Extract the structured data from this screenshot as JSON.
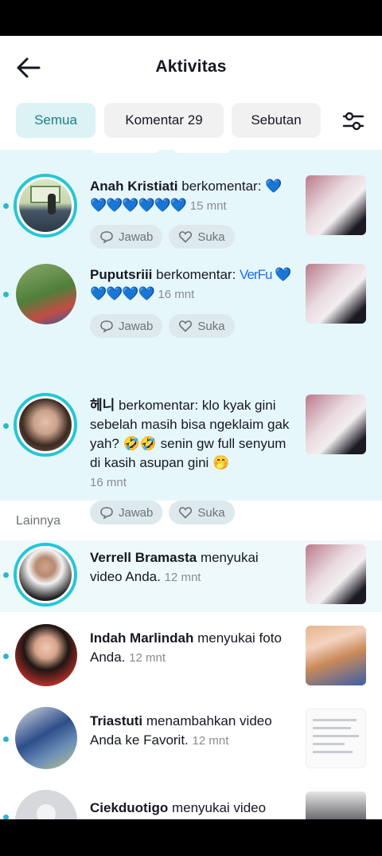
{
  "header": {
    "title": "Aktivitas",
    "back_icon": "arrow-left-icon"
  },
  "tabs": [
    {
      "label": "Semua",
      "active": true
    },
    {
      "label": "Komentar 29",
      "active": false
    },
    {
      "label": "Sebutan",
      "active": false
    }
  ],
  "filter_icon": "sliders-icon",
  "comments": [
    {
      "name": "Anah Kristiati",
      "verb": "berkomentar:",
      "text": "💙💙💙💙💙💙💙",
      "time": "15 mnt",
      "reply": "Jawab",
      "like": "Suka"
    },
    {
      "name": "Puputsriii",
      "verb": "berkomentar:",
      "text": "VerFu 💙💙💙💙💙",
      "time": "16 mnt",
      "reply": "Jawab",
      "like": "Suka"
    },
    {
      "name": "헤니",
      "verb": "berkomentar:",
      "text": "klo kyak gini sebelah masih bisa ngeklaim gak yah? 🤣🤣 senin gw full senyum di kasih asupan gini 🤭",
      "time": "16 mnt",
      "reply": "Jawab",
      "like": "Suka"
    }
  ],
  "section": {
    "label": "Lainnya"
  },
  "others": [
    {
      "name": "Verrell Bramasta",
      "action": "menyukai video Anda.",
      "time": "12 mnt"
    },
    {
      "name": "Indah Marlindah",
      "action": "menyukai foto Anda.",
      "time": "12 mnt"
    },
    {
      "name": "Triastuti",
      "action": "menambahkan video Anda ke Favorit.",
      "time": "12 mnt"
    },
    {
      "name": "Ciekduotigo",
      "action": "menyukai video",
      "time": ""
    }
  ],
  "colors": {
    "accent": "#25c6d6",
    "unread_bg": "#e6f7fb",
    "heart": "#1d6ee8"
  }
}
